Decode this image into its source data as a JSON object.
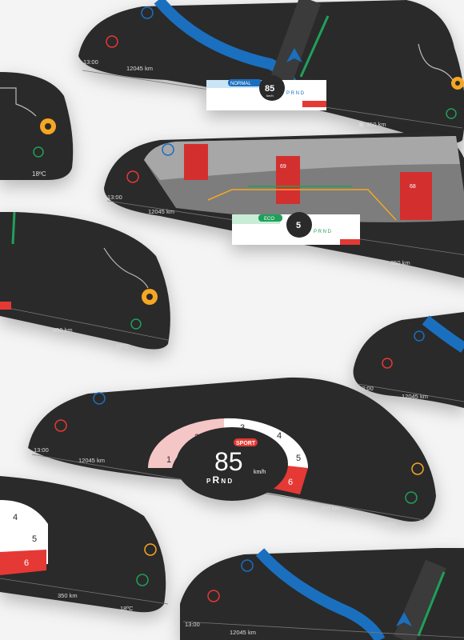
{
  "status": {
    "time": "13:00",
    "odometer": "12045 km",
    "range": "350 km",
    "temperature": "18ºC"
  },
  "modes": {
    "normal": {
      "label": "NORMAL",
      "speed": "85",
      "unit": "km/h",
      "color": "#1b6fbf"
    },
    "eco": {
      "label": "ECO",
      "speed": "5",
      "unit": "km/h",
      "color": "#1fa05a"
    },
    "sport": {
      "label": "SPORT",
      "speed": "85",
      "unit": "km/h",
      "color": "#e53935"
    }
  },
  "gear_selector": {
    "letters": [
      "P",
      "R",
      "N",
      "D"
    ]
  },
  "gear_bar": {
    "numbers": [
      "1",
      "2",
      "3",
      "4",
      "5",
      "6"
    ]
  },
  "parking_camera": {
    "pillar_labels": [
      "69",
      "68"
    ]
  },
  "colors": {
    "panel": "#2a2a2a",
    "accent_blue": "#1b6fbf",
    "accent_red": "#e53935",
    "accent_green": "#1fa05a",
    "accent_orange": "#f5a623"
  },
  "icons": [
    "music-icon",
    "car-icon",
    "navigation-pin-icon",
    "phone-icon",
    "fuel-icon",
    "navigation-arrow-icon"
  ]
}
